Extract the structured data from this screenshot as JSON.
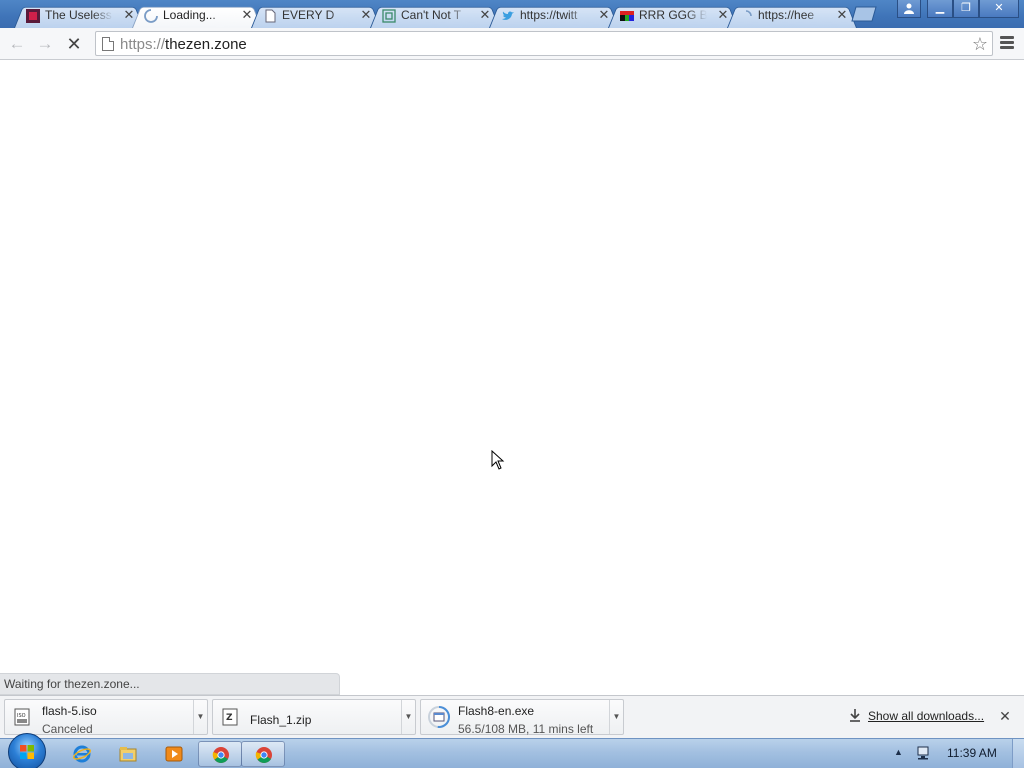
{
  "tabs": [
    {
      "title": "The Useless",
      "favicon": "useless-web-favicon",
      "active": false
    },
    {
      "title": "Loading...",
      "favicon": "loading-spinner-icon",
      "active": true
    },
    {
      "title": "EVERY D",
      "favicon": "document-icon",
      "active": false
    },
    {
      "title": "Can't Not T",
      "favicon": "target-favicon",
      "active": false
    },
    {
      "title": "https://twitt",
      "favicon": "twitter-bird-icon",
      "active": false
    },
    {
      "title": "RRR GGG Bl",
      "favicon": "rgb-flag-favicon",
      "active": false
    },
    {
      "title": "https://hee",
      "favicon": "loading-spinner-icon",
      "active": false
    }
  ],
  "toolbar": {
    "url_scheme": "https://",
    "url_host": "thezen.zone"
  },
  "status": {
    "text": "Waiting for thezen.zone..."
  },
  "downloads": {
    "items": [
      {
        "name": "flash-5.iso",
        "status": "Canceled",
        "icon": "iso-file-icon"
      },
      {
        "name": "Flash_1.zip",
        "status": "",
        "icon": "zip-file-icon"
      },
      {
        "name": "Flash8-en.exe",
        "status": "56.5/108 MB, 11 mins left",
        "icon": "exe-progress-icon",
        "progress": 0.52
      }
    ],
    "show_all_label": "Show all downloads..."
  },
  "taskbar": {
    "clock": "11:39 AM",
    "apps": [
      "internet-explorer-icon",
      "file-explorer-icon",
      "media-player-icon",
      "chrome-icon",
      "chrome-icon"
    ]
  },
  "colors": {
    "titlebar": "#3f74b8",
    "link": "#222222"
  }
}
